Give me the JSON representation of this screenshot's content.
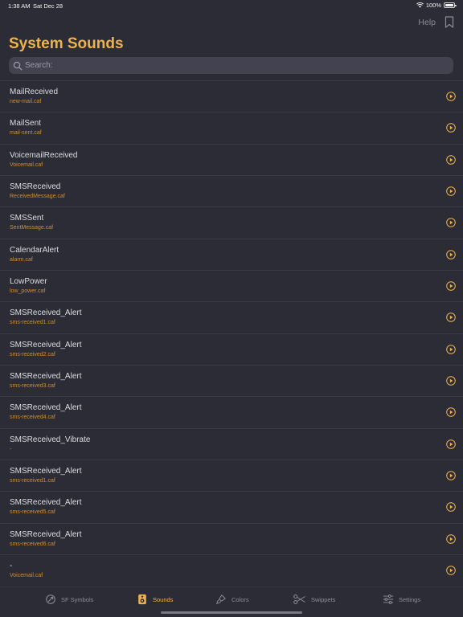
{
  "status_bar": {
    "time": "1:38 AM",
    "date": "Sat Dec 28",
    "battery": "100%"
  },
  "nav": {
    "help_label": "Help"
  },
  "page": {
    "title": "System Sounds"
  },
  "search": {
    "placeholder": "Search:"
  },
  "sounds": [
    {
      "name": "MailReceived",
      "file": "new-mail.caf"
    },
    {
      "name": "MailSent",
      "file": "mail-sent.caf"
    },
    {
      "name": "VoicemailReceived",
      "file": "Voicemail.caf"
    },
    {
      "name": "SMSReceived",
      "file": "ReceivedMessage.caf"
    },
    {
      "name": "SMSSent",
      "file": "SentMessage.caf"
    },
    {
      "name": "CalendarAlert",
      "file": "alarm.caf"
    },
    {
      "name": "LowPower",
      "file": "low_power.caf"
    },
    {
      "name": "SMSReceived_Alert",
      "file": "sms-received1.caf"
    },
    {
      "name": "SMSReceived_Alert",
      "file": "sms-received2.caf"
    },
    {
      "name": "SMSReceived_Alert",
      "file": "sms-received3.caf"
    },
    {
      "name": "SMSReceived_Alert",
      "file": "sms-received4.caf"
    },
    {
      "name": "SMSReceived_Vibrate",
      "file": "-"
    },
    {
      "name": "SMSReceived_Alert",
      "file": "sms-received1.caf"
    },
    {
      "name": "SMSReceived_Alert",
      "file": "sms-received5.caf"
    },
    {
      "name": "SMSReceived_Alert",
      "file": "sms-received6.caf"
    },
    {
      "name": "-",
      "file": "Voicemail.caf"
    }
  ],
  "tabs": [
    {
      "label": "SF Symbols",
      "icon": "sf-symbols-icon",
      "active": false
    },
    {
      "label": "Sounds",
      "icon": "speaker-icon",
      "active": true
    },
    {
      "label": "Colors",
      "icon": "paintbrush-icon",
      "active": false
    },
    {
      "label": "Swippets",
      "icon": "scissors-icon",
      "active": false
    },
    {
      "label": "Settings",
      "icon": "sliders-icon",
      "active": false
    }
  ],
  "colors": {
    "accent": "#eeb24c",
    "background": "#2c2c37",
    "file_text": "#cb8f32"
  }
}
